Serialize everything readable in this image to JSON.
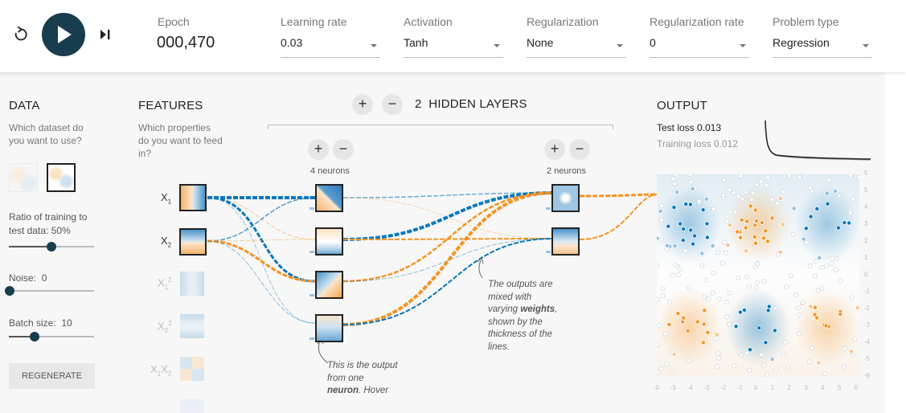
{
  "controls": {
    "reset_icon": "reset-icon",
    "play_icon": "play-icon",
    "step_icon": "step-icon"
  },
  "epoch": {
    "label": "Epoch",
    "value": "000,470"
  },
  "learning_rate": {
    "label": "Learning rate",
    "value": "0.03"
  },
  "activation": {
    "label": "Activation",
    "value": "Tanh"
  },
  "regularization": {
    "label": "Regularization",
    "value": "None"
  },
  "regularization_rate": {
    "label": "Regularization rate",
    "value": "0"
  },
  "problem_type": {
    "label": "Problem type",
    "value": "Regression"
  },
  "data": {
    "title": "DATA",
    "subtitle": "Which dataset do you want to use?",
    "ratio": {
      "label": "Ratio of training to test data:",
      "value": "50%",
      "level": 0.5
    },
    "noise": {
      "label": "Noise:",
      "value": "0",
      "level": 0
    },
    "batch": {
      "label": "Batch size:",
      "value": "10",
      "level": 0.3
    },
    "regenerate": "REGENERATE"
  },
  "features": {
    "title": "FEATURES",
    "subtitle": "Which properties do you want to feed in?",
    "items": [
      {
        "base": "X",
        "sub": "1",
        "sup": ""
      },
      {
        "base": "X",
        "sub": "2",
        "sup": ""
      },
      {
        "base": "X",
        "sub": "1",
        "sup": "2"
      },
      {
        "base": "X",
        "sub": "2",
        "sup": "2"
      },
      {
        "base": "X",
        "sub": "1",
        "sup": "",
        "base2": "X",
        "sub2": "2"
      }
    ]
  },
  "network": {
    "layer_count": "2",
    "layers_label": "HIDDEN LAYERS",
    "layer1_label": "4 neurons",
    "layer2_label": "2 neurons",
    "note_weights": [
      "The outputs are",
      "mixed with",
      "varying",
      "weights",
      ",",
      "shown by the",
      "thickness of the",
      "lines."
    ],
    "note_neuron": [
      "This is the output",
      "from one",
      "neuron",
      ". Hover"
    ]
  },
  "output": {
    "title": "OUTPUT",
    "test_loss": "Test loss 0.013",
    "training_loss": "Training loss 0.012",
    "y_ticks": [
      "5",
      "5",
      "4",
      "3",
      "2",
      "1",
      "0",
      "-1",
      "-2",
      "-3",
      "-4",
      "-5",
      "-6"
    ],
    "x_ticks": [
      "-0",
      "-5",
      "-4",
      "-3",
      "-2",
      "-1",
      "0",
      "1",
      "2",
      "3",
      "4",
      "5",
      "0"
    ]
  },
  "colors": {
    "positive": "#f59322",
    "negative": "#0877bd",
    "dark": "#183d4e"
  }
}
